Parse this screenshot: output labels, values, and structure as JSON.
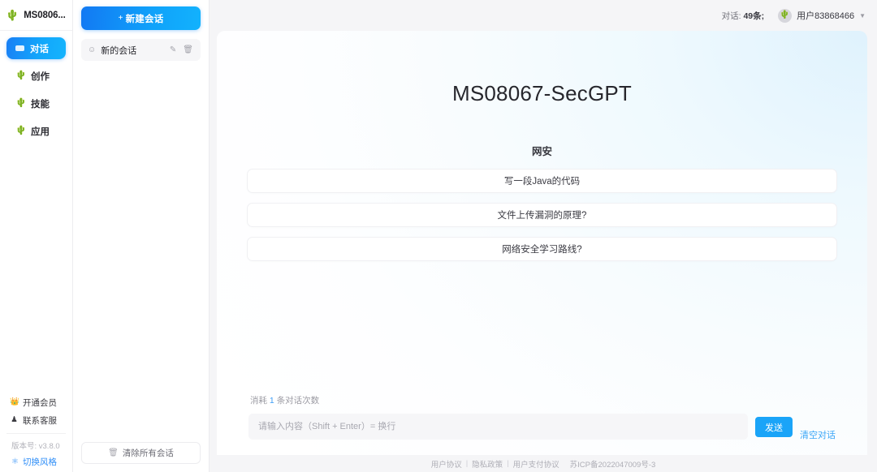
{
  "brand": {
    "logo_icon": "cactus-icon",
    "name": "MS0806..."
  },
  "sidebar": {
    "nav": [
      {
        "icon": "chat-icon",
        "label": "对话",
        "active": true
      },
      {
        "icon": "cactus-icon",
        "label": "创作",
        "active": false
      },
      {
        "icon": "cactus-icon",
        "label": "技能",
        "active": false
      },
      {
        "icon": "cactus-icon",
        "label": "应用",
        "active": false
      }
    ],
    "member_icon": "crown-icon",
    "member_label": "开通会员",
    "support_icon": "headset-icon",
    "support_label": "联系客服",
    "version_label": "版本号: v3.8.0",
    "theme_icon": "palette-icon",
    "theme_label": "切换风格"
  },
  "conversations": {
    "new_chat_plus": "+",
    "new_chat_label": "新建会话",
    "items": [
      {
        "icon": "speech-bubble-icon",
        "title": "新的会话",
        "edit_icon": "pencil-icon",
        "delete_icon": "trash-icon"
      }
    ],
    "clear_all_icon": "trash-icon",
    "clear_all_label": "清除所有会话"
  },
  "topbar": {
    "conversation_count_prefix": "对话:",
    "conversation_count_value": "49条;",
    "avatar_icon": "cactus-avatar-icon",
    "username": "用户83868466",
    "chevron_icon": "chevron-down-icon"
  },
  "main": {
    "title": "MS08067-SecGPT",
    "suggestions_heading": "网安",
    "suggestions": [
      "写一段Java的代码",
      "文件上传漏洞的原理?",
      "网络安全学习路线?"
    ]
  },
  "composer": {
    "quota_prefix": "消耗",
    "quota_number": "1",
    "quota_suffix": "条对话次数",
    "placeholder": "请输入内容（Shift + Enter）= 换行",
    "input_value": "",
    "send_label": "发送",
    "clear_label": "清空对话"
  },
  "footer": {
    "links": [
      "用户协议",
      "隐私政策",
      "用户支付协议"
    ],
    "separator": "|",
    "icp": "苏ICP备2022047009号-3"
  },
  "colors": {
    "accent_blue": "#1aa4f8",
    "gradient_start": "#1279f3",
    "gradient_end": "#12b2fd"
  }
}
